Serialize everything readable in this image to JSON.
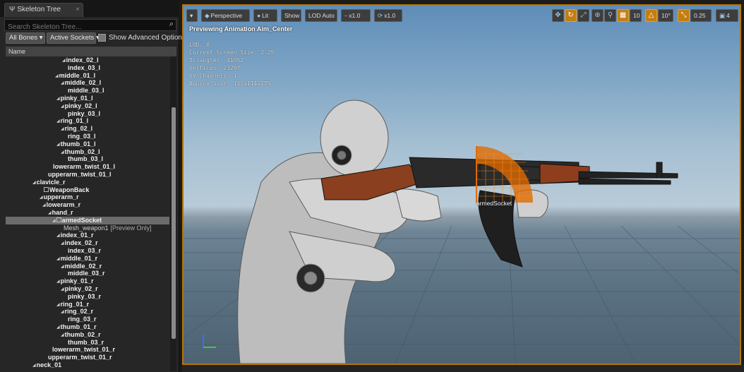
{
  "skeleton_tree": {
    "tab_title": "Skeleton Tree",
    "tab_icon": "bone-icon",
    "search_placeholder": "Search Skeleton Tree...",
    "bones_filter_label": "All Bones ▾",
    "sockets_filter_label": "Active Sockets ▾",
    "show_advanced_label": "Show Advanced Options",
    "column_header": "Name",
    "items": [
      {
        "label": "index_02_l",
        "indent": 80,
        "arrow": true
      },
      {
        "label": "index_03_l",
        "indent": 88,
        "arrow": false
      },
      {
        "label": "middle_01_l",
        "indent": 70,
        "arrow": true
      },
      {
        "label": "middle_02_l",
        "indent": 78,
        "arrow": true
      },
      {
        "label": "middle_03_l",
        "indent": 88,
        "arrow": false
      },
      {
        "label": "pinky_01_l",
        "indent": 72,
        "arrow": true
      },
      {
        "label": "pinky_02_l",
        "indent": 78,
        "arrow": true
      },
      {
        "label": "pinky_03_l",
        "indent": 88,
        "arrow": false
      },
      {
        "label": "ring_01_l",
        "indent": 72,
        "arrow": true
      },
      {
        "label": "ring_02_l",
        "indent": 78,
        "arrow": true
      },
      {
        "label": "ring_03_l",
        "indent": 88,
        "arrow": false
      },
      {
        "label": "thumb_01_l",
        "indent": 72,
        "arrow": true
      },
      {
        "label": "thumb_02_l",
        "indent": 78,
        "arrow": true
      },
      {
        "label": "thumb_03_l",
        "indent": 88,
        "arrow": false
      },
      {
        "label": "lowerarm_twist_01_l",
        "indent": 67,
        "arrow": false
      },
      {
        "label": "upperarm_twist_01_l",
        "indent": 60,
        "arrow": false
      },
      {
        "label": "clavicle_r",
        "indent": 38,
        "arrow": true
      },
      {
        "label": "WeaponBack",
        "indent": 54,
        "arrow": false,
        "socket": true
      },
      {
        "label": "upperarm_r",
        "indent": 48,
        "arrow": true
      },
      {
        "label": "lowerarm_r",
        "indent": 52,
        "arrow": true
      },
      {
        "label": "hand_r",
        "indent": 60,
        "arrow": true
      },
      {
        "label": "armedSocket",
        "indent": 66,
        "arrow": true,
        "socket": true,
        "selected": true
      },
      {
        "label": "Mesh_weapon1",
        "indent": 82,
        "arrow": false,
        "suffix": "[Preview Only]",
        "preview": true
      },
      {
        "label": "index_01_r",
        "indent": 72,
        "arrow": true
      },
      {
        "label": "index_02_r",
        "indent": 78,
        "arrow": true
      },
      {
        "label": "index_03_r",
        "indent": 88,
        "arrow": false
      },
      {
        "label": "middle_01_r",
        "indent": 72,
        "arrow": true
      },
      {
        "label": "middle_02_r",
        "indent": 78,
        "arrow": true
      },
      {
        "label": "middle_03_r",
        "indent": 88,
        "arrow": false
      },
      {
        "label": "pinky_01_r",
        "indent": 72,
        "arrow": true
      },
      {
        "label": "pinky_02_r",
        "indent": 78,
        "arrow": true
      },
      {
        "label": "pinky_03_r",
        "indent": 88,
        "arrow": false
      },
      {
        "label": "ring_01_r",
        "indent": 72,
        "arrow": true
      },
      {
        "label": "ring_02_r",
        "indent": 78,
        "arrow": true
      },
      {
        "label": "ring_03_r",
        "indent": 88,
        "arrow": false
      },
      {
        "label": "thumb_01_r",
        "indent": 72,
        "arrow": true
      },
      {
        "label": "thumb_02_r",
        "indent": 78,
        "arrow": true
      },
      {
        "label": "thumb_03_r",
        "indent": 88,
        "arrow": false
      },
      {
        "label": "lowerarm_twist_01_r",
        "indent": 66,
        "arrow": false
      },
      {
        "label": "upperarm_twist_01_r",
        "indent": 60,
        "arrow": false
      },
      {
        "label": "neck_01",
        "indent": 38,
        "arrow": true
      }
    ]
  },
  "viewport": {
    "toolbar": {
      "view_mode": "Perspective",
      "lighting": "Lit",
      "show": "Show",
      "lod": "LOD Auto",
      "speed": "x1.0",
      "playback_rate": "x1.0",
      "grid_snap": "10",
      "rotation_snap": "10°",
      "scale_snap": "0.25",
      "camera_speed": "4"
    },
    "preview_title": "Previewing Animation Aim_Center",
    "stats": [
      "LOD: 0",
      "Current Screen Size: 2.25",
      "Triangles: 41052",
      "Vertices: 23297",
      "UV Channels: 1",
      "Approx Size: 113x114x175"
    ],
    "selected_socket_label": "armedSocket",
    "accent_color": "#c47e10"
  }
}
